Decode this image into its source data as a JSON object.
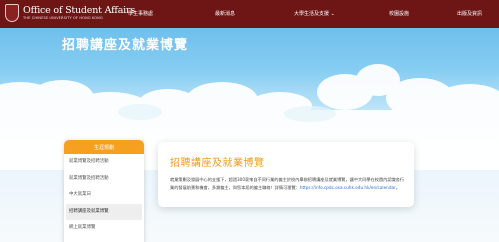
{
  "brand": {
    "title": "Office of Student Affairs",
    "subtitle": "THE CHINESE UNIVERSITY OF HONG KONG"
  },
  "nav": [
    "學生事務處",
    "最新消息",
    "大學生活及支援",
    "校園設施",
    "出版及資訊"
  ],
  "page_title": "招聘講座及就業博覽",
  "sidebar": {
    "header": "生涯規劃",
    "items": [
      "就業博覽及招聘活動",
      "就業博覽及招聘活動",
      "中大就業日",
      "招聘講座及就業博覽",
      "網上就業博覽"
    ],
    "active_index": 3
  },
  "content": {
    "title": "招聘講座及就業博覽",
    "body": "就業策劃及發展中心的支援下，超過300家來自不同行業的僱主於校內舉辦招聘講座及就業博覽，讓中大同學在校園內認識各行業的發展前景和機會，多謝僱主，與您本屆的僱主聯絡！詳情可瀏覽：",
    "link": "https://info.cpdc.osa.cuhk.edu.hk/en/calendar",
    "link_suffix": "。"
  },
  "colors": {
    "topbar": "#6e1616",
    "accent": "#f6a01f",
    "link": "#2b6fc7"
  }
}
